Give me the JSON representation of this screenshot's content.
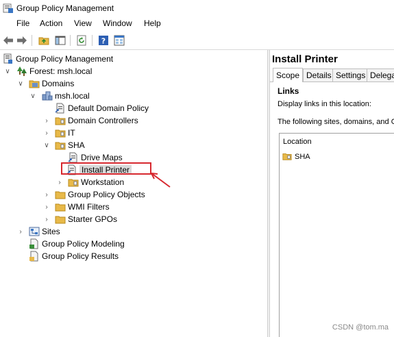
{
  "window": {
    "title": "Group Policy Management"
  },
  "menu": [
    "File",
    "Action",
    "View",
    "Window",
    "Help"
  ],
  "toolbar": {
    "buttons": [
      "back-arrow-icon",
      "forward-arrow-icon",
      "folder-up-icon",
      "show-hide-tree-icon",
      "refresh-icon",
      "help-icon",
      "properties-icon"
    ]
  },
  "tree": {
    "root": "Group Policy Management",
    "forest": "Forest: msh.local",
    "domains": "Domains",
    "domain": "msh.local",
    "default_policy": "Default Domain Policy",
    "domain_controllers": "Domain Controllers",
    "it": "IT",
    "sha": "SHA",
    "drive_maps": "Drive Maps",
    "install_printer": "Install Printer",
    "workstation": "Workstation",
    "gpo": "Group Policy Objects",
    "wmi": "WMI Filters",
    "starter": "Starter GPOs",
    "sites": "Sites",
    "modeling": "Group Policy Modeling",
    "results": "Group Policy Results"
  },
  "right": {
    "title": "Install Printer",
    "tabs": [
      "Scope",
      "Details",
      "Settings",
      "Delega"
    ],
    "active_tab": "Scope",
    "links_heading": "Links",
    "display_links": "Display links in this location:",
    "following_text": "The following sites, domains, and OU",
    "column_location": "Location",
    "location_item": "SHA"
  },
  "watermark": "CSDN @tom.ma",
  "colors": {
    "highlight_box": "#d7282f",
    "folder": "#e8b949",
    "selected_bg": "#d9d9d9"
  }
}
